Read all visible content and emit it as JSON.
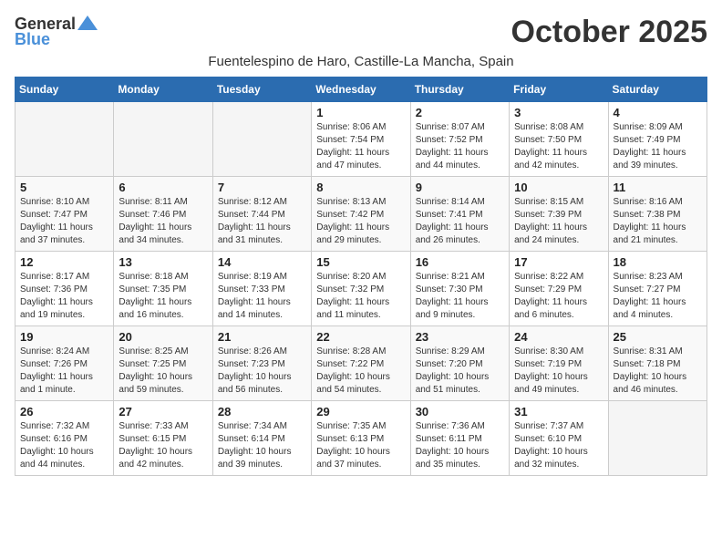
{
  "header": {
    "logo_general": "General",
    "logo_blue": "Blue",
    "month_title": "October 2025",
    "subtitle": "Fuentelespino de Haro, Castille-La Mancha, Spain"
  },
  "days_of_week": [
    "Sunday",
    "Monday",
    "Tuesday",
    "Wednesday",
    "Thursday",
    "Friday",
    "Saturday"
  ],
  "weeks": [
    [
      {
        "day": "",
        "info": ""
      },
      {
        "day": "",
        "info": ""
      },
      {
        "day": "",
        "info": ""
      },
      {
        "day": "1",
        "info": "Sunrise: 8:06 AM\nSunset: 7:54 PM\nDaylight: 11 hours and 47 minutes."
      },
      {
        "day": "2",
        "info": "Sunrise: 8:07 AM\nSunset: 7:52 PM\nDaylight: 11 hours and 44 minutes."
      },
      {
        "day": "3",
        "info": "Sunrise: 8:08 AM\nSunset: 7:50 PM\nDaylight: 11 hours and 42 minutes."
      },
      {
        "day": "4",
        "info": "Sunrise: 8:09 AM\nSunset: 7:49 PM\nDaylight: 11 hours and 39 minutes."
      }
    ],
    [
      {
        "day": "5",
        "info": "Sunrise: 8:10 AM\nSunset: 7:47 PM\nDaylight: 11 hours and 37 minutes."
      },
      {
        "day": "6",
        "info": "Sunrise: 8:11 AM\nSunset: 7:46 PM\nDaylight: 11 hours and 34 minutes."
      },
      {
        "day": "7",
        "info": "Sunrise: 8:12 AM\nSunset: 7:44 PM\nDaylight: 11 hours and 31 minutes."
      },
      {
        "day": "8",
        "info": "Sunrise: 8:13 AM\nSunset: 7:42 PM\nDaylight: 11 hours and 29 minutes."
      },
      {
        "day": "9",
        "info": "Sunrise: 8:14 AM\nSunset: 7:41 PM\nDaylight: 11 hours and 26 minutes."
      },
      {
        "day": "10",
        "info": "Sunrise: 8:15 AM\nSunset: 7:39 PM\nDaylight: 11 hours and 24 minutes."
      },
      {
        "day": "11",
        "info": "Sunrise: 8:16 AM\nSunset: 7:38 PM\nDaylight: 11 hours and 21 minutes."
      }
    ],
    [
      {
        "day": "12",
        "info": "Sunrise: 8:17 AM\nSunset: 7:36 PM\nDaylight: 11 hours and 19 minutes."
      },
      {
        "day": "13",
        "info": "Sunrise: 8:18 AM\nSunset: 7:35 PM\nDaylight: 11 hours and 16 minutes."
      },
      {
        "day": "14",
        "info": "Sunrise: 8:19 AM\nSunset: 7:33 PM\nDaylight: 11 hours and 14 minutes."
      },
      {
        "day": "15",
        "info": "Sunrise: 8:20 AM\nSunset: 7:32 PM\nDaylight: 11 hours and 11 minutes."
      },
      {
        "day": "16",
        "info": "Sunrise: 8:21 AM\nSunset: 7:30 PM\nDaylight: 11 hours and 9 minutes."
      },
      {
        "day": "17",
        "info": "Sunrise: 8:22 AM\nSunset: 7:29 PM\nDaylight: 11 hours and 6 minutes."
      },
      {
        "day": "18",
        "info": "Sunrise: 8:23 AM\nSunset: 7:27 PM\nDaylight: 11 hours and 4 minutes."
      }
    ],
    [
      {
        "day": "19",
        "info": "Sunrise: 8:24 AM\nSunset: 7:26 PM\nDaylight: 11 hours and 1 minute."
      },
      {
        "day": "20",
        "info": "Sunrise: 8:25 AM\nSunset: 7:25 PM\nDaylight: 10 hours and 59 minutes."
      },
      {
        "day": "21",
        "info": "Sunrise: 8:26 AM\nSunset: 7:23 PM\nDaylight: 10 hours and 56 minutes."
      },
      {
        "day": "22",
        "info": "Sunrise: 8:28 AM\nSunset: 7:22 PM\nDaylight: 10 hours and 54 minutes."
      },
      {
        "day": "23",
        "info": "Sunrise: 8:29 AM\nSunset: 7:20 PM\nDaylight: 10 hours and 51 minutes."
      },
      {
        "day": "24",
        "info": "Sunrise: 8:30 AM\nSunset: 7:19 PM\nDaylight: 10 hours and 49 minutes."
      },
      {
        "day": "25",
        "info": "Sunrise: 8:31 AM\nSunset: 7:18 PM\nDaylight: 10 hours and 46 minutes."
      }
    ],
    [
      {
        "day": "26",
        "info": "Sunrise: 7:32 AM\nSunset: 6:16 PM\nDaylight: 10 hours and 44 minutes."
      },
      {
        "day": "27",
        "info": "Sunrise: 7:33 AM\nSunset: 6:15 PM\nDaylight: 10 hours and 42 minutes."
      },
      {
        "day": "28",
        "info": "Sunrise: 7:34 AM\nSunset: 6:14 PM\nDaylight: 10 hours and 39 minutes."
      },
      {
        "day": "29",
        "info": "Sunrise: 7:35 AM\nSunset: 6:13 PM\nDaylight: 10 hours and 37 minutes."
      },
      {
        "day": "30",
        "info": "Sunrise: 7:36 AM\nSunset: 6:11 PM\nDaylight: 10 hours and 35 minutes."
      },
      {
        "day": "31",
        "info": "Sunrise: 7:37 AM\nSunset: 6:10 PM\nDaylight: 10 hours and 32 minutes."
      },
      {
        "day": "",
        "info": ""
      }
    ]
  ]
}
